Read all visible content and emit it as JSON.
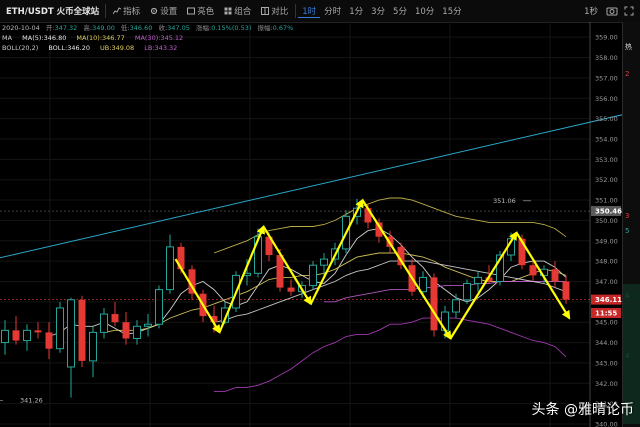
{
  "toolbar": {
    "pair": "ETH/USDT 火币全球站",
    "tools": [
      {
        "label": "指标",
        "icon": "indicator-icon"
      },
      {
        "label": "设置",
        "icon": "gear-icon"
      },
      {
        "label": "亮色",
        "icon": "theme-icon"
      },
      {
        "label": "组合",
        "icon": "grid-icon"
      },
      {
        "label": "对比",
        "icon": "compare-icon"
      }
    ],
    "timeframes": [
      "1时",
      "分时",
      "1分",
      "3分",
      "5分",
      "10分",
      "15分"
    ],
    "active_timeframe": "1时",
    "right_label": "1秒"
  },
  "info": {
    "ohlc": {
      "date": "2020-10-04",
      "items": [
        {
          "label": "开:",
          "value": "347.32"
        },
        {
          "label": "高:",
          "value": "349.00"
        },
        {
          "label": "低:",
          "value": "346.60"
        },
        {
          "label": "收:",
          "value": "347.05"
        },
        {
          "label": "涨幅:",
          "value": "0.15%(0.53)"
        },
        {
          "label": "振幅:",
          "value": "0.67%"
        }
      ]
    },
    "ma_line": [
      {
        "text": "MA",
        "color": "#cccccc"
      },
      {
        "text": "MA(5):346.80",
        "color": "#e8e8e8"
      },
      {
        "text": "MA(10):346.77",
        "color": "#e0d060"
      },
      {
        "text": "MA(30):345.12",
        "color": "#c060d0"
      }
    ],
    "boll_line": [
      {
        "text": "BOLL(20,2)",
        "color": "#cccccc"
      },
      {
        "text": "BOLL:346.20",
        "color": "#e8e8e8"
      },
      {
        "text": "UB:349.08",
        "color": "#e0d060"
      },
      {
        "text": "LB:343.32",
        "color": "#c060d0"
      }
    ]
  },
  "side": {
    "top_label": "热",
    "labels": [
      "2",
      "3",
      "5",
      "4",
      "4"
    ]
  },
  "watermark": "头条 @雅晴论币",
  "colors": {
    "up": "#26a69a",
    "down": "#e53935",
    "arrow": "#ffff00",
    "trend": "#2aa7c9",
    "ma5": "#e8e8e8",
    "ma10": "#e0d060",
    "ma30": "#c060d0",
    "boll_mid": "#d8d8d8",
    "boll_up": "#d0c050",
    "boll_low": "#b040c0"
  },
  "chart_data": {
    "type": "candlestick",
    "ylim": [
      340,
      359.5
    ],
    "yticks": [
      340,
      341,
      342,
      343,
      344,
      345,
      346,
      347,
      348,
      349,
      350,
      351,
      352,
      353,
      354,
      355,
      356,
      357,
      358,
      359
    ],
    "price_badges": [
      {
        "value": 350.46,
        "label": "350.46",
        "style": "highlight"
      },
      {
        "value": 346.11,
        "label": "346.11",
        "style": "last"
      },
      {
        "value": 345.55,
        "label": "11:55",
        "style": "timer"
      }
    ],
    "annotations": [
      {
        "text": "351.06",
        "x": 48,
        "y": 351.06
      },
      {
        "text": "341.26",
        "x": 0,
        "y": 341.26
      }
    ],
    "candles": [
      {
        "o": 344.0,
        "h": 345.1,
        "l": 343.4,
        "c": 344.6
      },
      {
        "o": 344.6,
        "h": 345.3,
        "l": 343.9,
        "c": 344.1
      },
      {
        "o": 344.1,
        "h": 344.9,
        "l": 343.6,
        "c": 344.6
      },
      {
        "o": 344.6,
        "h": 345.0,
        "l": 344.2,
        "c": 344.5
      },
      {
        "o": 344.5,
        "h": 345.0,
        "l": 343.2,
        "c": 343.7
      },
      {
        "o": 343.7,
        "h": 346.0,
        "l": 343.5,
        "c": 345.7
      },
      {
        "o": 342.8,
        "h": 346.2,
        "l": 341.3,
        "c": 346.1
      },
      {
        "o": 346.1,
        "h": 346.3,
        "l": 342.8,
        "c": 343.1
      },
      {
        "o": 343.1,
        "h": 344.8,
        "l": 342.3,
        "c": 344.5
      },
      {
        "o": 344.5,
        "h": 345.7,
        "l": 344.2,
        "c": 345.4
      },
      {
        "o": 345.4,
        "h": 346.0,
        "l": 344.8,
        "c": 345.0
      },
      {
        "o": 345.0,
        "h": 345.5,
        "l": 343.9,
        "c": 344.2
      },
      {
        "o": 344.2,
        "h": 345.1,
        "l": 343.9,
        "c": 344.8
      },
      {
        "o": 344.8,
        "h": 345.4,
        "l": 344.3,
        "c": 344.9
      },
      {
        "o": 344.9,
        "h": 346.8,
        "l": 344.7,
        "c": 346.6
      },
      {
        "o": 346.6,
        "h": 349.3,
        "l": 346.4,
        "c": 348.7
      },
      {
        "o": 348.7,
        "h": 348.9,
        "l": 347.4,
        "c": 347.6
      },
      {
        "o": 347.6,
        "h": 347.8,
        "l": 346.1,
        "c": 346.4
      },
      {
        "o": 346.4,
        "h": 346.6,
        "l": 345.0,
        "c": 345.3
      },
      {
        "o": 345.3,
        "h": 345.8,
        "l": 344.5,
        "c": 345.0
      },
      {
        "o": 345.0,
        "h": 346.0,
        "l": 344.9,
        "c": 345.7
      },
      {
        "o": 345.7,
        "h": 347.5,
        "l": 345.5,
        "c": 347.3
      },
      {
        "o": 347.3,
        "h": 348.1,
        "l": 346.8,
        "c": 347.4
      },
      {
        "o": 347.4,
        "h": 349.6,
        "l": 347.2,
        "c": 349.2
      },
      {
        "o": 349.2,
        "h": 349.4,
        "l": 348.0,
        "c": 348.3
      },
      {
        "o": 348.3,
        "h": 348.6,
        "l": 346.5,
        "c": 346.7
      },
      {
        "o": 346.7,
        "h": 347.1,
        "l": 346.3,
        "c": 346.5
      },
      {
        "o": 346.5,
        "h": 347.0,
        "l": 346.2,
        "c": 346.8
      },
      {
        "o": 346.8,
        "h": 348.0,
        "l": 346.6,
        "c": 347.8
      },
      {
        "o": 347.8,
        "h": 348.4,
        "l": 347.3,
        "c": 348.1
      },
      {
        "o": 348.1,
        "h": 348.9,
        "l": 347.8,
        "c": 348.6
      },
      {
        "o": 348.6,
        "h": 350.5,
        "l": 348.4,
        "c": 350.2
      },
      {
        "o": 350.2,
        "h": 351.06,
        "l": 349.8,
        "c": 350.6
      },
      {
        "o": 350.6,
        "h": 350.8,
        "l": 349.6,
        "c": 349.9
      },
      {
        "o": 349.9,
        "h": 350.1,
        "l": 348.9,
        "c": 349.2
      },
      {
        "o": 349.2,
        "h": 349.5,
        "l": 348.4,
        "c": 348.7
      },
      {
        "o": 348.7,
        "h": 348.9,
        "l": 347.6,
        "c": 347.8
      },
      {
        "o": 347.8,
        "h": 348.1,
        "l": 346.3,
        "c": 346.5
      },
      {
        "o": 346.5,
        "h": 347.5,
        "l": 346.2,
        "c": 347.2
      },
      {
        "o": 347.2,
        "h": 347.4,
        "l": 344.3,
        "c": 344.6
      },
      {
        "o": 344.6,
        "h": 345.8,
        "l": 344.2,
        "c": 345.5
      },
      {
        "o": 345.5,
        "h": 346.4,
        "l": 345.2,
        "c": 346.1
      },
      {
        "o": 346.1,
        "h": 347.1,
        "l": 345.9,
        "c": 346.9
      },
      {
        "o": 346.9,
        "h": 347.5,
        "l": 346.5,
        "c": 347.2
      },
      {
        "o": 347.2,
        "h": 347.8,
        "l": 346.9,
        "c": 347.0
      },
      {
        "o": 347.0,
        "h": 348.5,
        "l": 346.8,
        "c": 348.3
      },
      {
        "o": 348.3,
        "h": 349.4,
        "l": 348.0,
        "c": 349.1
      },
      {
        "o": 349.1,
        "h": 349.3,
        "l": 347.6,
        "c": 347.8
      },
      {
        "o": 347.8,
        "h": 348.1,
        "l": 347.0,
        "c": 347.3
      },
      {
        "o": 347.3,
        "h": 347.8,
        "l": 346.9,
        "c": 347.6
      },
      {
        "o": 347.6,
        "h": 348.0,
        "l": 346.7,
        "c": 347.0
      },
      {
        "o": 347.0,
        "h": 347.3,
        "l": 345.9,
        "c": 346.11
      }
    ],
    "series": [
      {
        "name": "MA(5)",
        "color_key": "ma5",
        "values": [
          null,
          null,
          null,
          null,
          344.3,
          344.5,
          344.9,
          344.8,
          344.8,
          345.0,
          344.7,
          344.4,
          344.5,
          344.7,
          344.9,
          345.6,
          346.4,
          346.8,
          347.0,
          346.6,
          346.0,
          345.8,
          346.0,
          346.8,
          347.6,
          347.8,
          347.6,
          347.3,
          347.0,
          346.9,
          347.4,
          348.3,
          349.1,
          349.5,
          349.6,
          349.3,
          348.8,
          348.2,
          347.7,
          347.0,
          346.6,
          346.2,
          346.0,
          346.2,
          346.6,
          347.1,
          347.7,
          347.9,
          348.0,
          348.0,
          347.7,
          347.2
        ]
      },
      {
        "name": "MA(10)",
        "color_key": "ma10",
        "values": [
          null,
          null,
          null,
          null,
          null,
          null,
          null,
          null,
          null,
          344.5,
          344.6,
          344.6,
          344.6,
          344.7,
          344.9,
          345.2,
          345.4,
          345.6,
          345.7,
          345.9,
          346.1,
          346.3,
          346.5,
          346.8,
          347.1,
          347.2,
          347.2,
          347.3,
          347.3,
          347.4,
          347.6,
          347.9,
          348.2,
          348.3,
          348.4,
          348.4,
          348.4,
          348.3,
          348.2,
          348.0,
          347.7,
          347.5,
          347.3,
          347.1,
          347.0,
          347.0,
          347.0,
          347.2,
          347.4,
          347.6,
          347.5,
          347.3
        ]
      },
      {
        "name": "MA(30)",
        "color_key": "ma30",
        "values": [
          null,
          null,
          null,
          null,
          null,
          null,
          null,
          null,
          null,
          null,
          null,
          null,
          null,
          null,
          null,
          null,
          null,
          null,
          null,
          null,
          null,
          null,
          null,
          null,
          null,
          null,
          null,
          null,
          null,
          346.0,
          346.0,
          346.2,
          346.3,
          346.4,
          346.5,
          346.6,
          346.6,
          346.6,
          346.7,
          346.7,
          346.8,
          346.8,
          346.8,
          346.9,
          346.9,
          347.0,
          347.0,
          347.0,
          347.0,
          347.0,
          347.0,
          347.0
        ]
      },
      {
        "name": "BOLL",
        "color_key": "boll_mid",
        "values": [
          null,
          null,
          null,
          null,
          null,
          null,
          null,
          null,
          null,
          null,
          null,
          null,
          null,
          null,
          null,
          null,
          null,
          null,
          null,
          345.0,
          345.1,
          345.3,
          345.4,
          345.6,
          345.8,
          346.0,
          346.2,
          346.4,
          346.6,
          346.8,
          347.0,
          347.3,
          347.5,
          347.6,
          347.8,
          348.0,
          348.0,
          348.0,
          348.0,
          347.9,
          347.8,
          347.7,
          347.6,
          347.5,
          347.4,
          347.3,
          347.2,
          347.1,
          347.0,
          346.9,
          346.7,
          346.5
        ]
      },
      {
        "name": "UB",
        "color_key": "boll_up",
        "values": [
          null,
          null,
          null,
          null,
          null,
          null,
          null,
          null,
          null,
          null,
          null,
          null,
          null,
          null,
          null,
          null,
          null,
          null,
          null,
          348.4,
          348.6,
          348.8,
          349.0,
          349.3,
          349.5,
          349.6,
          349.7,
          349.7,
          349.7,
          349.8,
          350.0,
          350.3,
          350.6,
          350.8,
          351.0,
          351.1,
          351.1,
          351.0,
          350.8,
          350.6,
          350.4,
          350.2,
          350.1,
          350.0,
          349.9,
          349.9,
          349.9,
          349.9,
          349.9,
          349.8,
          349.6,
          349.2
        ]
      },
      {
        "name": "LB",
        "color_key": "boll_low",
        "values": [
          null,
          null,
          null,
          null,
          null,
          null,
          null,
          null,
          null,
          null,
          null,
          null,
          null,
          null,
          null,
          null,
          null,
          null,
          null,
          341.6,
          341.6,
          341.8,
          341.8,
          341.9,
          342.1,
          342.4,
          342.7,
          343.1,
          343.5,
          343.8,
          344.0,
          344.3,
          344.4,
          344.4,
          344.6,
          344.9,
          344.9,
          345.0,
          345.2,
          345.2,
          345.2,
          345.2,
          345.1,
          345.0,
          344.9,
          344.7,
          344.5,
          344.3,
          344.1,
          344.0,
          343.8,
          343.3
        ]
      }
    ],
    "trendline": {
      "from": {
        "x": -5,
        "y": 347.6
      },
      "to": {
        "x": 57,
        "y": 355.3
      }
    },
    "arrows": [
      {
        "from": {
          "x": 15.5,
          "y": 348.1
        },
        "to": {
          "x": 19.5,
          "y": 344.5
        }
      },
      {
        "from": {
          "x": 19.5,
          "y": 344.5
        },
        "to": {
          "x": 23.5,
          "y": 349.7
        }
      },
      {
        "from": {
          "x": 23.5,
          "y": 349.7
        },
        "to": {
          "x": 27.8,
          "y": 345.9
        }
      },
      {
        "from": {
          "x": 27.8,
          "y": 345.9
        },
        "to": {
          "x": 32.5,
          "y": 351.0
        }
      },
      {
        "from": {
          "x": 32.5,
          "y": 351.0
        },
        "to": {
          "x": 40.5,
          "y": 344.2
        }
      },
      {
        "from": {
          "x": 40.5,
          "y": 344.2
        },
        "to": {
          "x": 46.5,
          "y": 349.4
        }
      },
      {
        "from": {
          "x": 46.5,
          "y": 349.4
        },
        "to": {
          "x": 51.3,
          "y": 345.2
        }
      }
    ]
  }
}
